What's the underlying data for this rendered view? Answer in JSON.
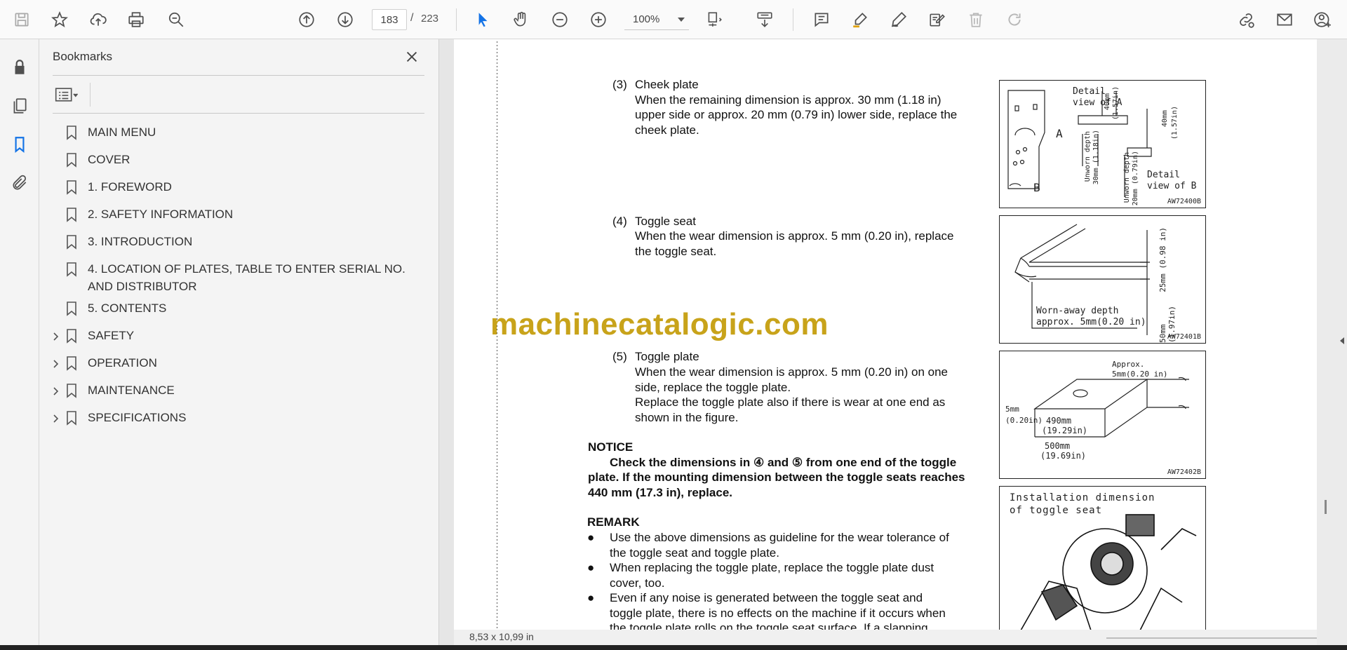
{
  "toolbar": {
    "page_current": "183",
    "page_separator": "/",
    "page_total": "223",
    "zoom": "100%"
  },
  "bookmarks": {
    "title": "Bookmarks",
    "items": [
      {
        "label": "MAIN MENU",
        "expandable": false
      },
      {
        "label": "COVER",
        "expandable": false
      },
      {
        "label": "1. FOREWORD",
        "expandable": false
      },
      {
        "label": "2. SAFETY INFORMATION",
        "expandable": false
      },
      {
        "label": "3. INTRODUCTION",
        "expandable": false
      },
      {
        "label": "4. LOCATION OF PLATES, TABLE TO ENTER SERIAL NO. AND DISTRIBUTOR",
        "expandable": false
      },
      {
        "label": "5. CONTENTS",
        "expandable": false
      },
      {
        "label": "SAFETY",
        "expandable": true
      },
      {
        "label": "OPERATION",
        "expandable": true
      },
      {
        "label": "MAINTENANCE",
        "expandable": true
      },
      {
        "label": "SPECIFICATIONS",
        "expandable": true
      }
    ]
  },
  "document": {
    "s3_num": "(3)",
    "s3_title": "Cheek plate",
    "s3_l1": "When the remaining dimension is approx. 30 mm (1.18 in)",
    "s3_l2": "upper side or approx. 20 mm (0.79 in) lower side, replace the",
    "s3_l3": "cheek plate.",
    "s4_num": "(4)",
    "s4_title": "Toggle seat",
    "s4_l1": "When the wear dimension is approx. 5 mm (0.20 in), replace",
    "s4_l2": "the toggle seat.",
    "s5_num": "(5)",
    "s5_title": "Toggle plate",
    "s5_l1": "When the wear dimension is approx. 5 mm (0.20 in) on one",
    "s5_l2": "side, replace the toggle plate.",
    "s5_l3": "Replace the toggle plate also if there is wear at one end as",
    "s5_l4": "shown in the figure.",
    "notice_head": "NOTICE",
    "notice_l1": "Check the dimensions in ④ and ⑤ from one end of the toggle",
    "notice_l2": "plate. If the mounting dimension between the toggle seats reaches",
    "notice_l3": "440 mm (17.3 in), replace.",
    "remark_head": "REMARK",
    "r1_l1": "Use the above dimensions as guideline for the wear tolerance of",
    "r1_l2": "the toggle seat and toggle plate.",
    "r2_l1": "When replacing the toggle plate, replace the toggle plate dust",
    "r2_l2": "cover, too.",
    "r3_l1": "Even if any noise is generated between the toggle seat and",
    "r3_l2": "toggle plate, there is no effects on the machine if it occurs when",
    "r3_l3": "the toggle plate rolls on the toggle seat surface. If a slapping",
    "bullet": "●",
    "fig1_caption": "AW72400B",
    "fig1_t1": "Detail",
    "fig1_t2": "view of A",
    "fig1_t3": "Detail",
    "fig1_t4": "view of B",
    "fig1_a": "A",
    "fig1_b": "B",
    "fig1_d1": "40mm",
    "fig1_d2": "(1.57in)",
    "fig1_d3": "Unworn depth",
    "fig1_d4": "30mm (1.18in)",
    "fig1_d5": "20mm (0.79in)",
    "fig2_caption": "AW72401B",
    "fig2_t1": "Worn-away depth",
    "fig2_t2": "approx. 5mm(0.20 in)",
    "fig2_d1": "25mm (0.98 in)",
    "fig2_d2": "50mm (1.97in)",
    "fig3_caption": "AW72402B",
    "fig3_t1": "Approx.",
    "fig3_t2": "5mm(0.20 in)",
    "fig3_t3": "5mm",
    "fig3_t4": "(0.20in)",
    "fig3_t5": "490mm",
    "fig3_t6": "(19.29in)",
    "fig3_t7": "500mm",
    "fig3_t8": "(19.69in)",
    "fig4_t1": "Installation dimension",
    "fig4_t2": "of toggle seat",
    "watermark": "machinecatalogic.com"
  },
  "status": {
    "page_size": "8,53 x 10,99 in"
  },
  "colors": {
    "accent": "#1473e6",
    "watermark": "#c8a31a"
  }
}
